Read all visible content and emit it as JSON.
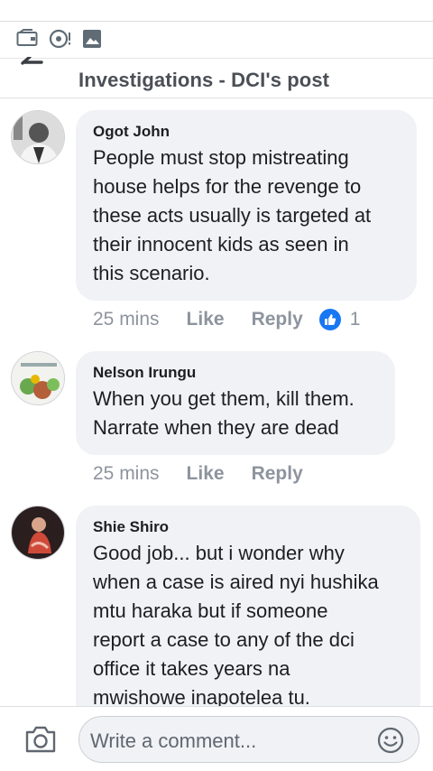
{
  "header": {
    "title": "Investigations - DCI's post"
  },
  "comments": [
    {
      "author": "Ogot John",
      "lines": [
        "People must stop mistreating",
        "house helps for the revenge to",
        "these acts usually is targeted at",
        "their innocent kids as seen in",
        "this scenario."
      ],
      "time": "25 mins",
      "like_label": "Like",
      "reply_label": "Reply",
      "reaction_count": "1"
    },
    {
      "author": "Nelson Irungu",
      "lines": [
        "When you get them, kill them.",
        "Narrate when they are dead"
      ],
      "time": "25 mins",
      "like_label": "Like",
      "reply_label": "Reply"
    },
    {
      "author": "Shie Shiro",
      "lines": [
        "Good job... but i wonder why",
        "when a case is aired nyi hushika",
        "mtu haraka but if someone",
        "report a case to any of the dci",
        "office it takes years na",
        "mwishowe inapotelea tu."
      ]
    }
  ],
  "composer": {
    "placeholder": "Write a comment..."
  },
  "colors": {
    "accent": "#1877f2",
    "bubble": "#f0f2f5",
    "muted": "#8d949e"
  },
  "icons": [
    "back-arrow-icon",
    "wallet-icon",
    "sync-alert-icon",
    "image-icon",
    "like-reaction-icon",
    "camera-icon",
    "emoji-icon"
  ]
}
